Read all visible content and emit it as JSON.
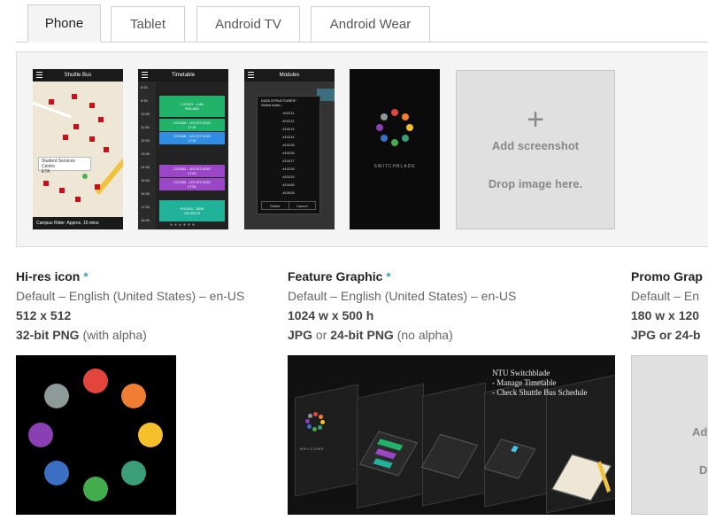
{
  "tabs": [
    {
      "label": "Phone",
      "active": true
    },
    {
      "label": "Tablet",
      "active": false
    },
    {
      "label": "Android TV",
      "active": false
    },
    {
      "label": "Android Wear",
      "active": false
    }
  ],
  "screenshots": {
    "shot1": {
      "title": "Shuttle Bus",
      "callout_title": "Student Services Centre",
      "callout_sub": "ETA",
      "footer": "Campus Rider: Approx. 15 mins"
    },
    "shot2": {
      "title": "Timetable",
      "times": [
        "8:30",
        "9:30",
        "10:30",
        "11:30",
        "12:30",
        "13:30",
        "14:30",
        "15:30",
        "16:30",
        "17:30",
        "18:30"
      ],
      "events": [
        {
          "line1": "CZ1007 - LAB",
          "line2": "SWLAB2"
        },
        {
          "line1": "CZ1006 - LEC/STUDIO",
          "line2": "LT19"
        },
        {
          "line1": "CZ1006 - LEC/STUDIO",
          "line2": "LT19"
        },
        {
          "line1": "CZ2003 - LEC/STUDIO",
          "line2": "LT2A"
        },
        {
          "line1": "CZ1006 - LEC/STUDIO",
          "line2": "LT2A"
        },
        {
          "line1": "PH1001 - SEM",
          "line2": "SS-SR3.5"
        }
      ]
    },
    "shot3": {
      "title": "Modules",
      "dialog_title": "DATA STRUCTURES*",
      "dialog_sub": "Select index...",
      "items": [
        "#10211",
        "#10212",
        "#10213",
        "#10214",
        "#10215",
        "#10216",
        "#10217",
        "#10218",
        "#10219",
        "#10448",
        "#10928"
      ],
      "cancel": "Delete",
      "ok": "Cancel"
    },
    "shot4": {
      "brand": "SWITCHBLADE"
    }
  },
  "add_screenshot": {
    "plus": "+",
    "label": "Add screenshot",
    "drop": "Drop image here."
  },
  "hires_icon": {
    "title": "Hi-res icon",
    "required_mark": "*",
    "locale": "Default – English (United States) – en-US",
    "size": "512 x 512",
    "format_bold": "32-bit PNG",
    "format_note": "(with alpha)"
  },
  "feature_graphic": {
    "title": "Feature Graphic",
    "required_mark": "*",
    "locale": "Default – English (United States) – en-US",
    "size": "1024 w x 500 h",
    "format_a": "JPG",
    "format_or": "or",
    "format_b": "24-bit PNG",
    "format_note": "(no alpha)",
    "image_title": "NTU Switchblade",
    "image_line1": "- Manage Timetable",
    "image_line2": "- Check Shuttle Bus Schedule",
    "welcome": "WELCOME"
  },
  "promo_graphic": {
    "title": "Promo Grap",
    "locale": "Default – En",
    "size": "180 w x 120",
    "format": "JPG or 24-b",
    "add_label": "Ad",
    "drop_label": "D"
  },
  "colors": {
    "dot_red": "#e2453c",
    "dot_orange": "#ef7e33",
    "dot_yellow": "#f5c02a",
    "dot_teal": "#3a9e7a",
    "dot_green": "#43ad4e",
    "dot_blue": "#3b6fc4",
    "dot_purple": "#8a3fb2",
    "dot_gray": "#8d9a98",
    "accent_required": "#3ea1c2"
  }
}
